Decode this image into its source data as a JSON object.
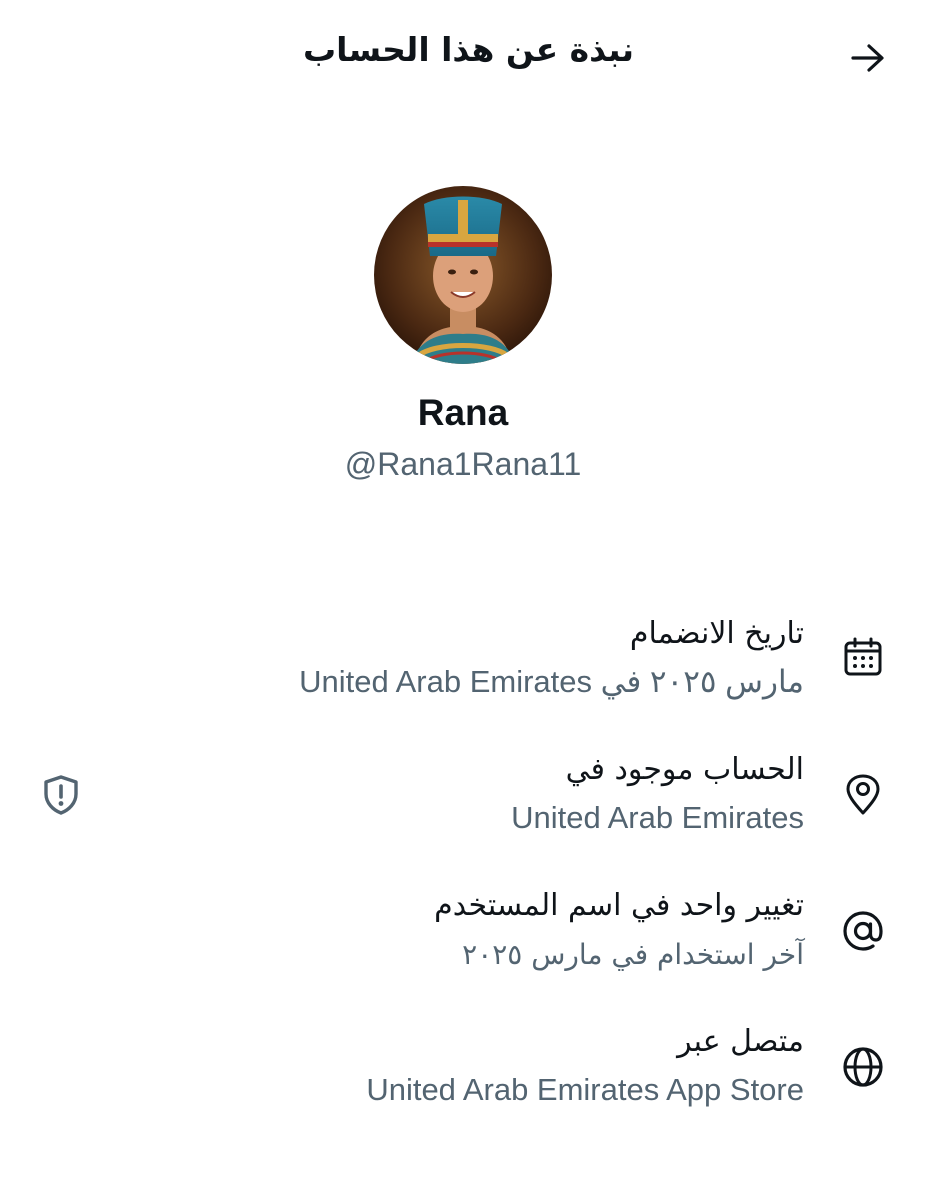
{
  "header": {
    "title": "نبذة عن هذا الحساب"
  },
  "profile": {
    "display_name": "Rana",
    "handle": "@Rana1Rana11"
  },
  "rows": [
    {
      "icon": "calendar-icon",
      "title": "تاريخ الانضمام",
      "value": "مارس ٢٠٢٥ في United Arab Emirates"
    },
    {
      "icon": "location-pin-icon",
      "title": "الحساب موجود في",
      "value": "United Arab Emirates"
    },
    {
      "icon": "at-sign-icon",
      "title": "تغيير واحد في اسم المستخدم",
      "value": "آخر استخدام في مارس ٢٠٢٥"
    },
    {
      "icon": "globe-icon",
      "title": "متصل عبر",
      "value": "United Arab Emirates App Store"
    }
  ],
  "colors": {
    "primary_text": "#0f1419",
    "secondary_text": "#536471"
  }
}
